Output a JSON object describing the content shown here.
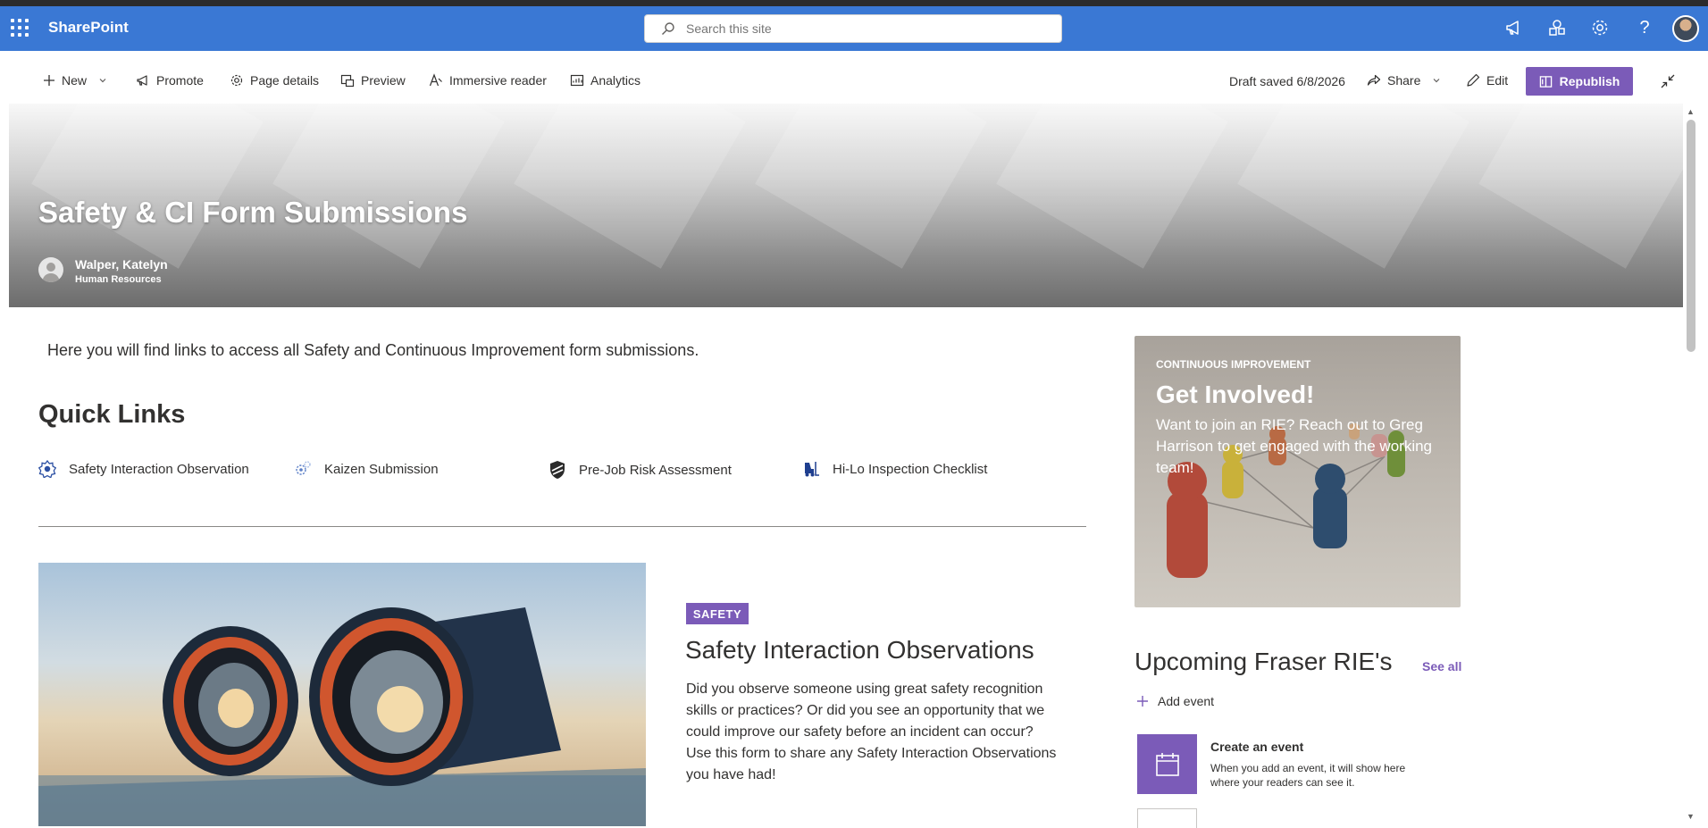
{
  "suite": {
    "app_name": "SharePoint",
    "search_placeholder": "Search this site"
  },
  "toolbar": {
    "new_label": "New",
    "promote_label": "Promote",
    "page_details_label": "Page details",
    "preview_label": "Preview",
    "immersive_reader_label": "Immersive reader",
    "analytics_label": "Analytics",
    "draft_status": "Draft saved 6/8/2026",
    "share_label": "Share",
    "edit_label": "Edit",
    "republish_label": "Republish"
  },
  "hero": {
    "title": "Safety & CI Form Submissions",
    "author": "Walper, Katelyn",
    "department": "Human Resources"
  },
  "intro_text": "Here you will find links to access all Safety and Continuous Improvement form submissions.",
  "quick_links": {
    "title": "Quick Links",
    "items": [
      {
        "label": "Safety Interaction Observation",
        "icon": "safety-badge-icon"
      },
      {
        "label": "Kaizen Submission",
        "icon": "kaizen-gear-icon"
      },
      {
        "label": "Pre-Job Risk Assessment",
        "icon": "shield-icon"
      },
      {
        "label": "Hi-Lo Inspection Checklist",
        "icon": "forklift-icon"
      }
    ]
  },
  "article": {
    "tag": "SAFETY",
    "title": "Safety Interaction Observations",
    "body": "Did you observe someone using great safety recognition skills or practices? Or did you see an opportunity that we could improve our safety before an incident can occur? Use this form to share any Safety Interaction Observations you have had!"
  },
  "ci_card": {
    "eyebrow": "CONTINUOUS IMPROVEMENT",
    "title": "Get Involved!",
    "body": "Want to join an RIE? Reach out to Greg Harrison to get engaged with the working team!"
  },
  "events": {
    "title": "Upcoming Fraser RIE's",
    "see_all_label": "See all",
    "add_event_label": "Add event",
    "create_title": "Create an event",
    "create_desc": "When you add an event, it will show here where your readers can see it."
  },
  "colors": {
    "suite_bar": "#3a78d4",
    "accent": "#7b5bb8",
    "text": "#323130"
  }
}
